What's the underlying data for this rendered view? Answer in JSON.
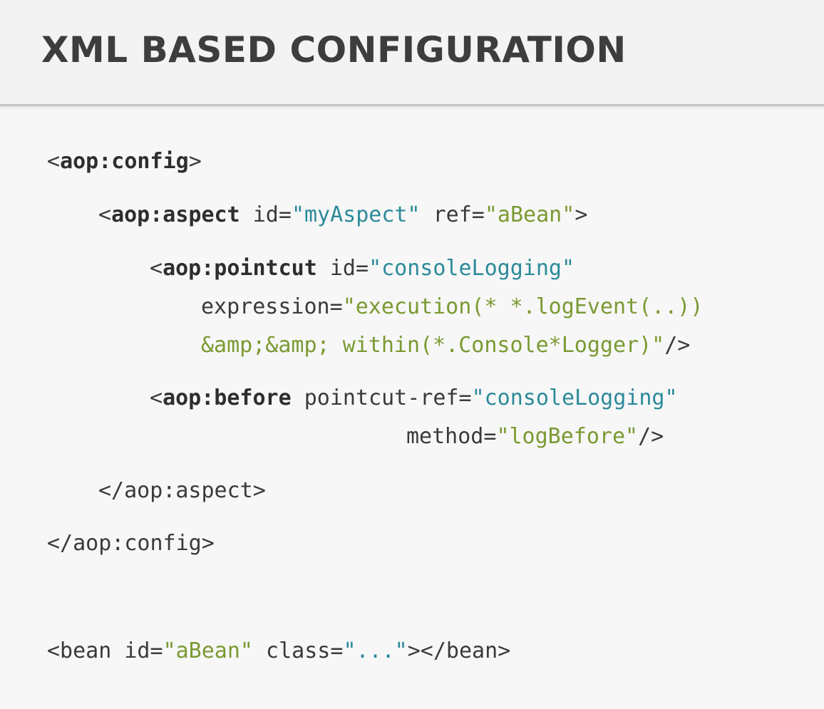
{
  "slide": {
    "title": "XML BASED CONFIGURATION"
  },
  "code": {
    "line1": {
      "open": "<",
      "tag": "aop:config",
      "close": ">"
    },
    "line2": {
      "open": "<",
      "tag": "aop:aspect",
      "attr1": " id=",
      "val1": "\"myAspect\"",
      "attr2": " ref=",
      "val2": "\"aBean\"",
      "close": ">"
    },
    "line3": {
      "open": "<",
      "tag": "aop:pointcut",
      "attr1": " id=",
      "val1": "\"consoleLogging\""
    },
    "line4": {
      "attr": "expression=",
      "val": "\"execution(* *.logEvent(..))"
    },
    "line5": {
      "val": "&amp;&amp; within(*.Console*Logger)\"",
      "close": "/>"
    },
    "line6": {
      "open": "<",
      "tag": "aop:before",
      "attr1": " pointcut-ref=",
      "val1": "\"consoleLogging\""
    },
    "line7": {
      "attr": "method=",
      "val": "\"logBefore\"",
      "close": "/>"
    },
    "line8": {
      "text": "</aop:aspect>"
    },
    "line9": {
      "text": "</aop:config>"
    },
    "line10": {
      "open": "<bean",
      "attr1": " id=",
      "val1": "\"aBean\"",
      "attr2": " class=",
      "val2": "\"...\"",
      "close": "></bean>"
    }
  },
  "colors": {
    "teal": "#2b8a9a",
    "green": "#7a9a32",
    "text": "#3a3a3a",
    "title": "#3d3d3d"
  }
}
